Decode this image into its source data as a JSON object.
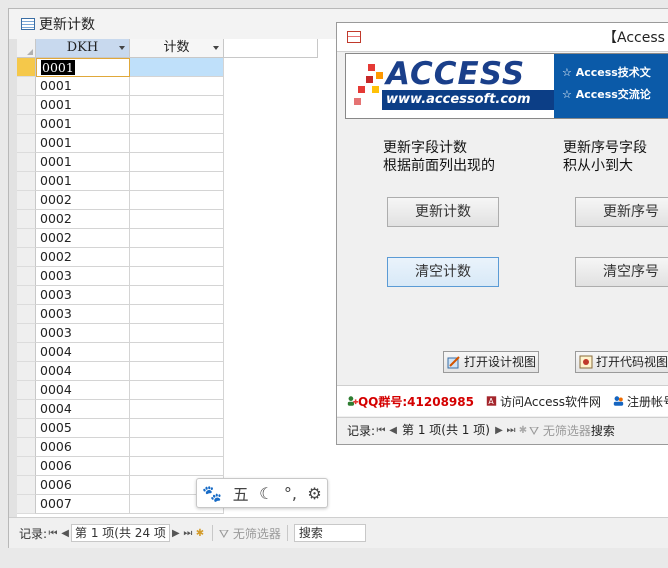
{
  "colors": {
    "accent": "#0b5aa8",
    "selected_row": "#f5c84a",
    "qq": "#d40000"
  },
  "datasheet": {
    "title": "更新计数",
    "columns": [
      "DKH",
      "计数"
    ],
    "rows": [
      "0001",
      "0001",
      "0001",
      "0001",
      "0001",
      "0001",
      "0001",
      "0002",
      "0002",
      "0002",
      "0002",
      "0003",
      "0003",
      "0003",
      "0003",
      "0004",
      "0004",
      "0004",
      "0004",
      "0005",
      "0006",
      "0006",
      "0006",
      "0007"
    ],
    "nav": {
      "label": "记录:",
      "position": "第 1 项(共 24 项",
      "filter": "无筛选器",
      "search": "搜索"
    }
  },
  "form": {
    "title": "【Access",
    "banner": {
      "logo": "ACCESS",
      "url": "www.accessoft.com",
      "line1": "☆ Access技术文",
      "line2": "☆ Access交流论"
    },
    "label_left": [
      "更新字段计数",
      "根据前面列出现的"
    ],
    "label_right": [
      "更新序号字段",
      "积从小到大"
    ],
    "btn_update_count": "更新计数",
    "btn_update_seq": "更新序号",
    "btn_clear_count": "清空计数",
    "btn_clear_seq": "清空序号",
    "btn_design": "打开设计视图",
    "btn_code": "打开代码视图",
    "qq": "QQ群号:41208985",
    "visit": "访问Access软件网",
    "register": "注册帐号",
    "nav": {
      "label": "记录:",
      "position": "第 1 项(共 1 项)",
      "filter": "无筛选器",
      "search": "搜索"
    }
  },
  "ime": {
    "icons": [
      "paw-icon",
      "wu-icon",
      "moon-icon",
      "punct-icon",
      "gear-icon"
    ],
    "wu": "五"
  }
}
